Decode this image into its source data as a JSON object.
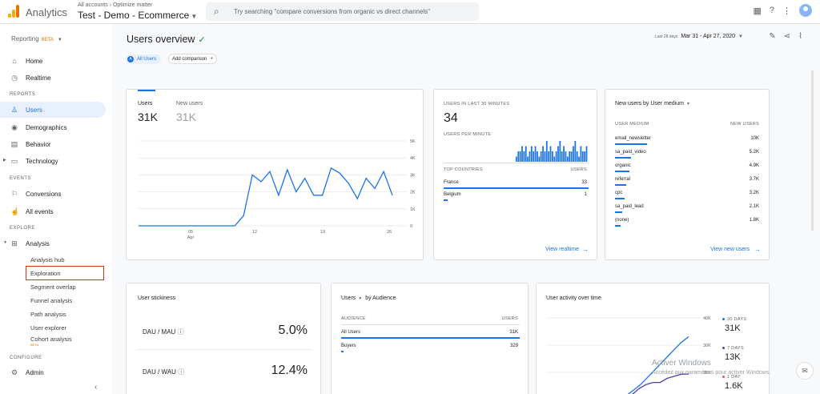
{
  "header": {
    "app_name": "Analytics",
    "breadcrumb": "All accounts › Optimize matter",
    "property": "Test - Demo - Ecommerce",
    "search_placeholder": "Try searching \"compare conversions from organic vs direct channels\""
  },
  "sidebar": {
    "reporting": "Reporting",
    "reporting_badge": "BETA",
    "home": "Home",
    "realtime": "Realtime",
    "reports_label": "REPORTS",
    "users": "Users",
    "demographics": "Demographics",
    "behavior": "Behavior",
    "technology": "Technology",
    "events_label": "EVENTS",
    "conversions": "Conversions",
    "all_events": "All events",
    "explore_label": "EXPLORE",
    "analysis": "Analysis",
    "subs": [
      "Analysis hub",
      "Exploration",
      "Segment overlap",
      "Funnel analysis",
      "Path analysis",
      "User explorer",
      "Cohort analysis"
    ],
    "cohort_badge": "BETA",
    "configure_label": "CONFIGURE",
    "admin": "Admin"
  },
  "main": {
    "title": "Users overview",
    "date_label": "Last 28 days",
    "date_range": "Mar 31 - Apr 27, 2020",
    "chip_all": "All Users",
    "chip_add": "Add comparison"
  },
  "users_card": {
    "users_label": "Users",
    "users_value": "31K",
    "new_label": "New users",
    "new_value": "31K",
    "y_ticks": [
      "5K",
      "4K",
      "3K",
      "2K",
      "1K",
      "0"
    ],
    "x_ticks": [
      "05",
      "12",
      "19",
      "26"
    ],
    "x_sub": "Apr"
  },
  "realtime_card": {
    "title": "USERS IN LAST 30 MINUTES",
    "value": "34",
    "per_min": "USERS PER MINUTE",
    "top_countries": "TOP COUNTRIES",
    "users_col": "USERS",
    "rows": [
      {
        "name": "France",
        "value": "33"
      },
      {
        "name": "Belgium",
        "value": "1"
      }
    ],
    "link": "View realtime"
  },
  "medium_card": {
    "title": "New users by User medium",
    "col1": "USER MEDIUM",
    "col2": "NEW USERS",
    "rows": [
      {
        "name": "email_newsletter",
        "value": "10K"
      },
      {
        "name": "sa_paid_video",
        "value": "5.2K"
      },
      {
        "name": "organic",
        "value": "4.9K"
      },
      {
        "name": "referral",
        "value": "3.7K"
      },
      {
        "name": "cpc",
        "value": "3.2K"
      },
      {
        "name": "sa_paid_lead",
        "value": "2.1K"
      },
      {
        "name": "(none)",
        "value": "1.8K"
      }
    ],
    "link": "View new users"
  },
  "stickiness_card": {
    "title": "User stickiness",
    "rows": [
      {
        "name": "DAU / MAU",
        "value": "5.0%"
      },
      {
        "name": "DAU / WAU",
        "value": "12.4%"
      }
    ]
  },
  "audience_card": {
    "title_a": "Users",
    "title_b": "by Audience",
    "col1": "AUDIENCE",
    "col2": "USERS",
    "rows": [
      {
        "name": "All Users",
        "value": "31K"
      },
      {
        "name": "Buyers",
        "value": "329"
      }
    ]
  },
  "activity_card": {
    "title": "User activity over time",
    "y_ticks": [
      "40K",
      "30K",
      "20K"
    ],
    "legend": [
      {
        "name": "30 DAYS",
        "value": "31K"
      },
      {
        "name": "7 DAYS",
        "value": "13K"
      },
      {
        "name": "1 DAY",
        "value": "1.6K"
      }
    ]
  },
  "watermark": {
    "line1": "Activer Windows",
    "line2": "Accédez aux paramètres pour activer Windows."
  },
  "chart_data": [
    {
      "type": "line",
      "x": [
        "Mar 31",
        "Apr 1",
        "Apr 2",
        "Apr 3",
        "Apr 4",
        "Apr 5",
        "Apr 6",
        "Apr 7",
        "Apr 8",
        "Apr 9",
        "Apr 10",
        "Apr 11",
        "Apr 12",
        "Apr 13",
        "Apr 14",
        "Apr 15",
        "Apr 16",
        "Apr 17",
        "Apr 18",
        "Apr 19",
        "Apr 20",
        "Apr 21",
        "Apr 22",
        "Apr 23",
        "Apr 24",
        "Apr 25",
        "Apr 26",
        "Apr 27"
      ],
      "series": [
        {
          "name": "Users",
          "values": [
            0,
            0,
            0,
            0,
            0,
            0,
            0,
            0,
            0,
            0,
            0,
            0,
            600,
            3000,
            2600,
            3200,
            1800,
            3300,
            2000,
            2800,
            1800,
            1800,
            3400,
            3100,
            2500,
            1600,
            2800,
            2200,
            3200,
            1800
          ]
        }
      ],
      "ylim": [
        0,
        5000
      ],
      "grid": true
    },
    {
      "type": "bar",
      "series": [
        {
          "name": "Users per minute",
          "values": [
            1,
            2,
            2,
            3,
            2,
            3,
            1,
            2,
            3,
            2,
            3,
            2,
            1,
            2,
            3,
            2,
            4,
            2,
            3,
            2,
            1,
            2,
            3,
            4,
            2,
            3,
            2,
            1,
            2,
            2,
            3,
            4,
            2,
            1,
            3,
            2,
            2,
            3
          ]
        }
      ]
    },
    {
      "type": "line",
      "series": [
        {
          "name": "30 DAYS",
          "values": [
            0,
            2000,
            5000,
            8000,
            12000,
            16000,
            20000,
            24000,
            28000,
            31000
          ]
        },
        {
          "name": "7 DAYS",
          "values": [
            0,
            3000,
            6000,
            8000,
            9000,
            9000,
            11000,
            12000,
            13000,
            13000
          ]
        }
      ],
      "ylim": [
        0,
        40000
      ]
    }
  ]
}
